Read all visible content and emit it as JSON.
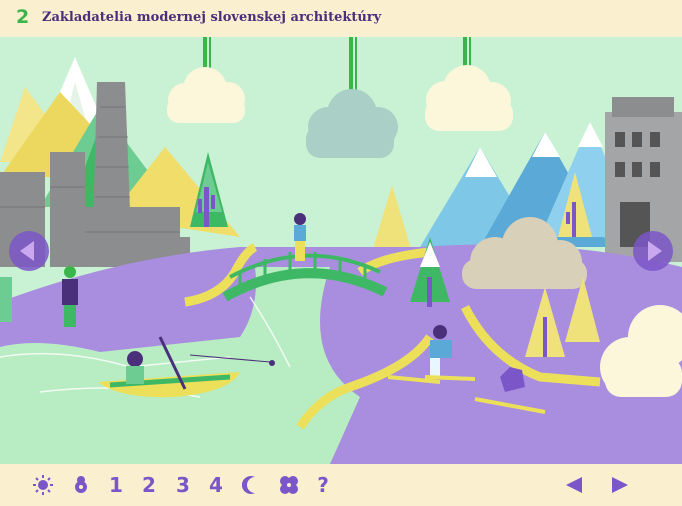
{
  "header": {
    "chapter_number": "2",
    "title": "Zakladatelia modernej slovenskej architektúry"
  },
  "colors": {
    "accent_green": "#3ab54a",
    "accent_purple": "#7b56c8",
    "title_purple": "#4a2f7a",
    "background_cream": "#faf0cf"
  },
  "scene": {
    "left_arrow_icon": "chevron-left-circle-icon",
    "right_arrow_icon": "chevron-right-circle-icon"
  },
  "footer": {
    "nav_items": [
      {
        "type": "icon",
        "icon": "sun-icon"
      },
      {
        "type": "icon",
        "icon": "flower-icon"
      },
      {
        "type": "text",
        "label": "1"
      },
      {
        "type": "text",
        "label": "2"
      },
      {
        "type": "text",
        "label": "3"
      },
      {
        "type": "text",
        "label": "4"
      },
      {
        "type": "icon",
        "icon": "moon-icon"
      },
      {
        "type": "icon",
        "icon": "clover-icon"
      },
      {
        "type": "text",
        "label": "?"
      }
    ],
    "prev_icon": "triangle-left-icon",
    "next_icon": "triangle-right-icon"
  }
}
